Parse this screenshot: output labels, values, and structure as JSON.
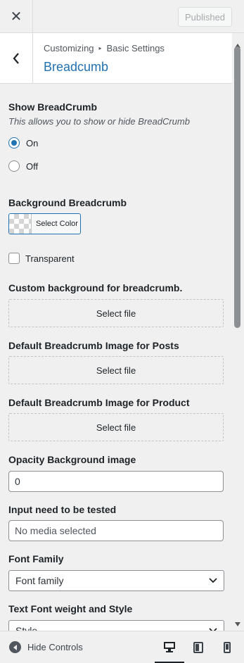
{
  "topbar": {
    "close_icon": "✕",
    "published_label": "Published"
  },
  "panel": {
    "breadcrumb_root": "Customizing",
    "breadcrumb_sep": "▸",
    "breadcrumb_section": "Basic Settings",
    "title": "Breadcumb"
  },
  "show_breadcrumb": {
    "label": "Show BreadCrumb",
    "description": "This allows you to show or hide BreadCrumb",
    "options": [
      {
        "label": "On",
        "checked": true
      },
      {
        "label": "Off",
        "checked": false
      }
    ]
  },
  "background_breadcrumb": {
    "label": "Background Breadcrumb",
    "button_label": "Select Color"
  },
  "transparent": {
    "label": "Transparent",
    "checked": false
  },
  "custom_background": {
    "label": "Custom background for breadcrumb.",
    "button_label": "Select file"
  },
  "default_posts": {
    "label": "Default Breadcrumb Image for Posts",
    "button_label": "Select file"
  },
  "default_product": {
    "label": "Default Breadcrumb Image for Product",
    "button_label": "Select file"
  },
  "opacity": {
    "label": "Opacity Background image",
    "value": "0"
  },
  "input_tested": {
    "label": "Input need to be tested",
    "value": "No media selected"
  },
  "font_family": {
    "label": "Font Family",
    "selected": "Font family"
  },
  "font_weight": {
    "label": "Text Font weight and Style",
    "selected": "Style"
  },
  "footer": {
    "hide_controls_label": "Hide Controls",
    "devices": [
      "desktop",
      "tablet",
      "mobile"
    ],
    "active_device": "desktop"
  },
  "colors": {
    "accent": "#2271b1",
    "text": "#1d2327",
    "muted": "#50575e",
    "panel_bg": "#f0f0f1"
  }
}
